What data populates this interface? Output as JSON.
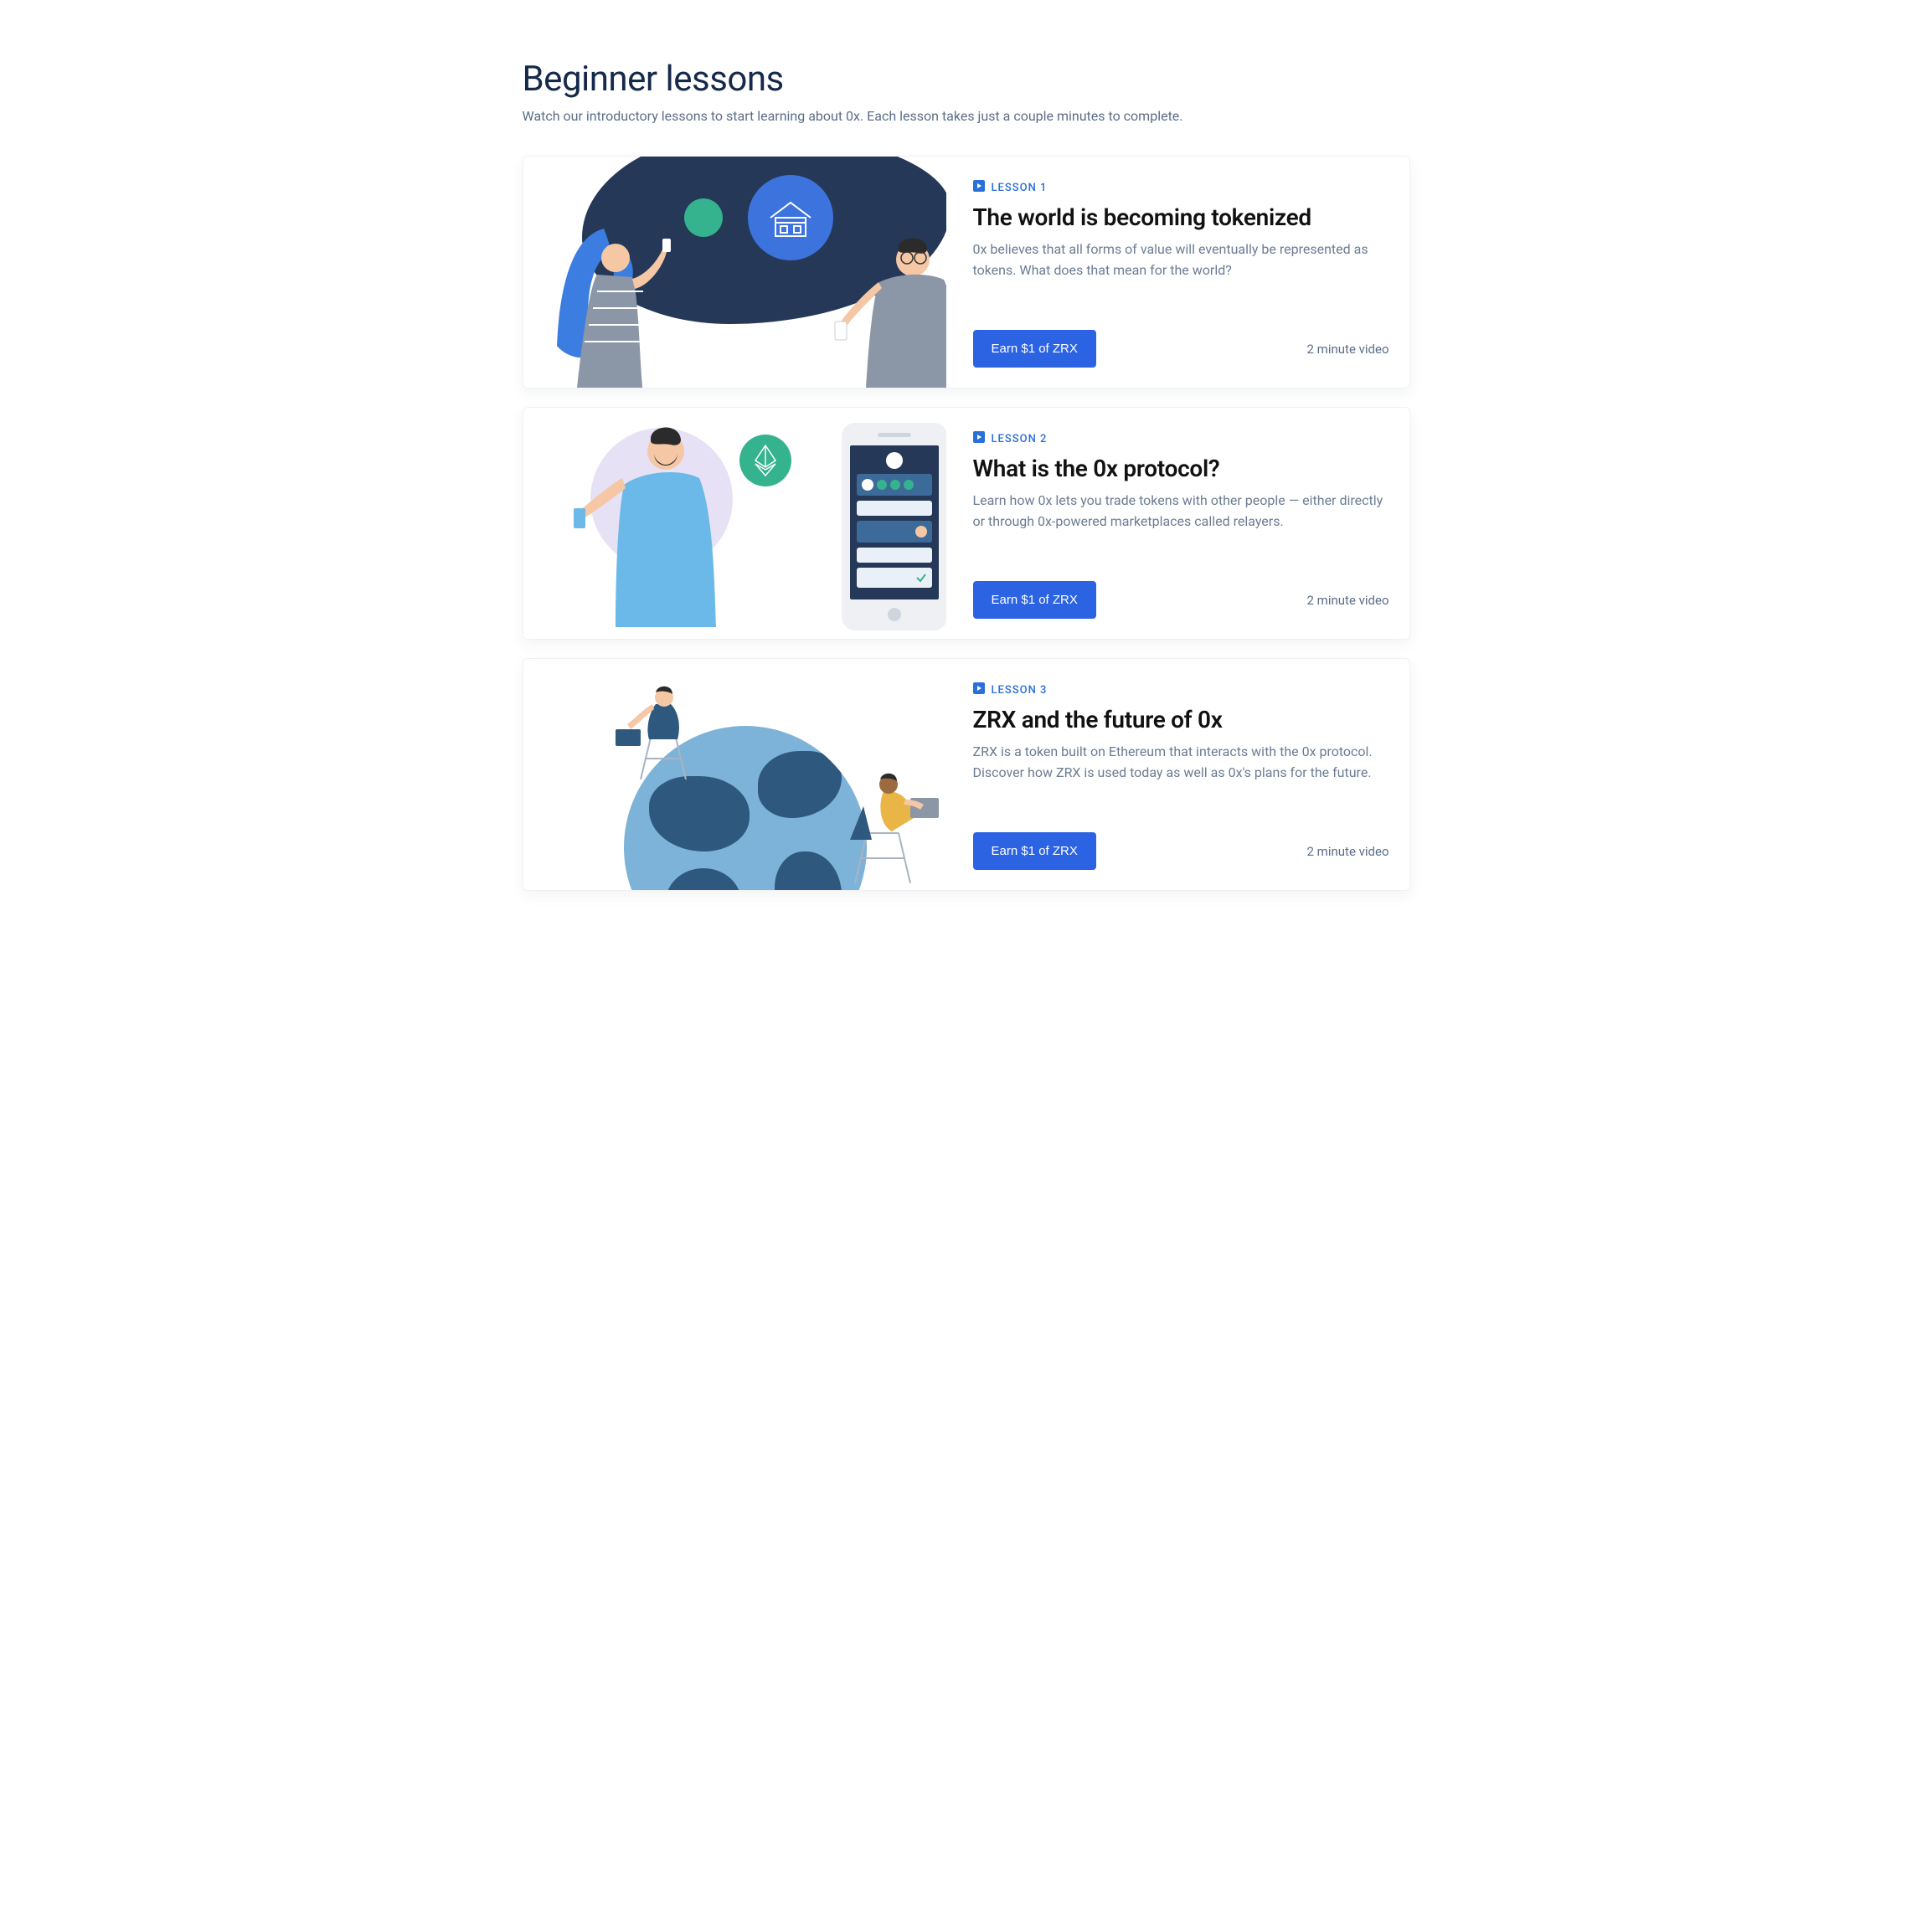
{
  "section": {
    "title": "Beginner lessons",
    "subtitle": "Watch our introductory lessons to start learning about 0x. Each lesson takes just a couple minutes to complete."
  },
  "lessons": [
    {
      "eyebrow": "LESSON 1",
      "title": "The world is becoming tokenized",
      "description": "0x believes that all forms of value will eventually be represented as tokens. What does that mean for the world?",
      "cta": "Earn $1 of ZRX",
      "duration": "2 minute video"
    },
    {
      "eyebrow": "LESSON 2",
      "title": "What is the 0x protocol?",
      "description": "Learn how 0x lets you trade tokens with other people — either directly or through 0x-powered marketplaces called relayers.",
      "cta": "Earn $1 of ZRX",
      "duration": "2 minute video"
    },
    {
      "eyebrow": "LESSON 3",
      "title": "ZRX and the future of 0x",
      "description": "ZRX is a token built on Ethereum that interacts with the 0x protocol. Discover how ZRX is used today as well as 0x's plans for the future.",
      "cta": "Earn $1 of ZRX",
      "duration": "2 minute video"
    }
  ]
}
